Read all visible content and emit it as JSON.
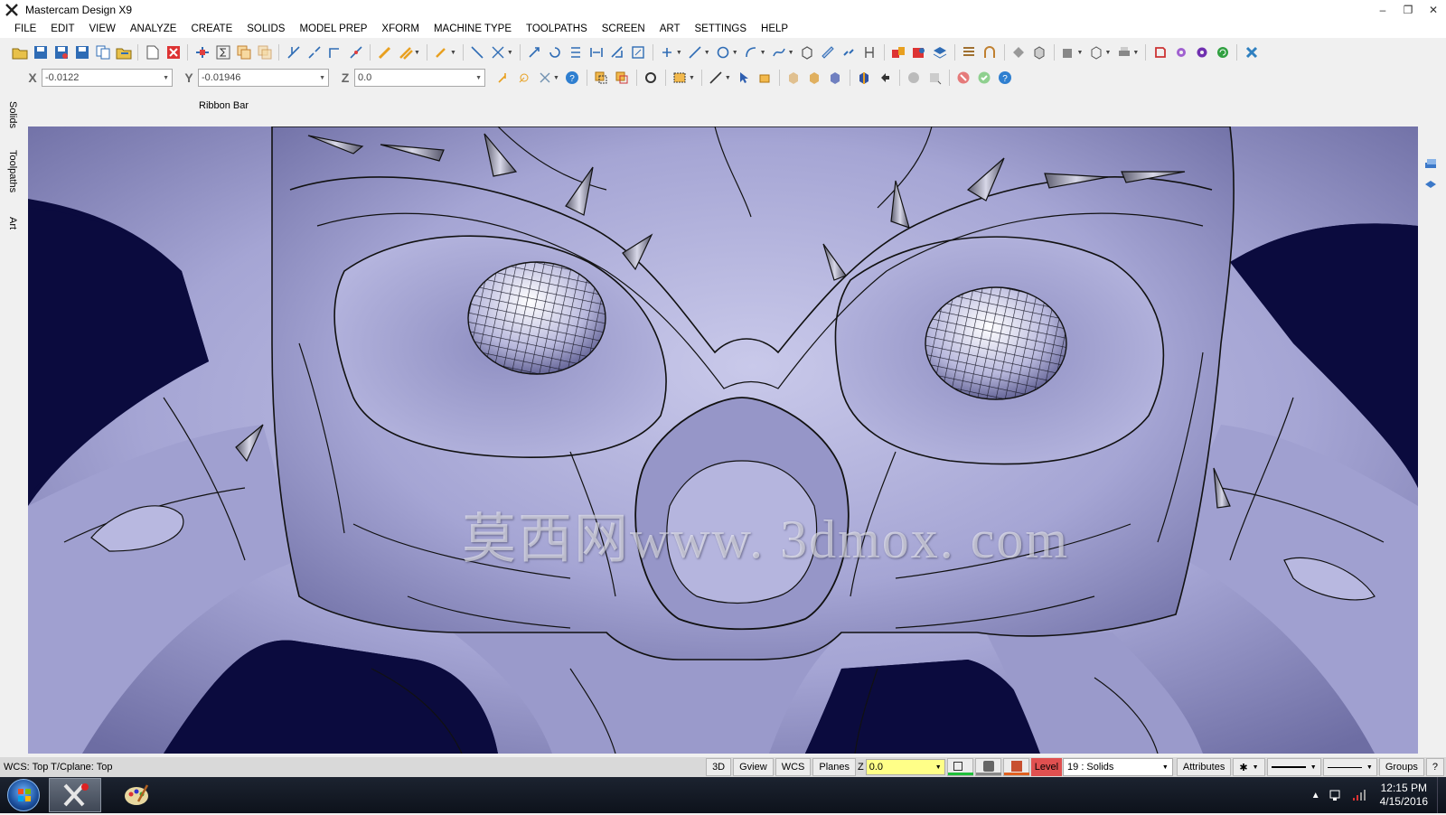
{
  "window": {
    "title": "Mastercam Design X9"
  },
  "menu": [
    "FILE",
    "EDIT",
    "VIEW",
    "ANALYZE",
    "CREATE",
    "SOLIDS",
    "MODEL PREP",
    "XFORM",
    "MACHINE TYPE",
    "TOOLPATHS",
    "SCREEN",
    "ART",
    "SETTINGS",
    "HELP"
  ],
  "coords": {
    "x_label": "X",
    "x_value": "-0.0122",
    "y_label": "Y",
    "y_value": "-0.01946",
    "z_label": "Z",
    "z_value": "0.0"
  },
  "ribbon_label": "Ribbon Bar",
  "side_tabs": [
    "Solids",
    "Toolpaths",
    "Art"
  ],
  "watermark": "莫西网www. 3dmox. com",
  "status": {
    "wcs": "WCS: Top  T/Cplane: Top",
    "btn_3d": "3D",
    "gview": "Gview",
    "wcs_btn": "WCS",
    "planes": "Planes",
    "z_label": "Z",
    "z_value": "0.0",
    "level_label": "Level",
    "level_value": "19 : Solids",
    "attributes": "Attributes",
    "groups": "Groups",
    "help": "?"
  },
  "taskbar": {
    "time": "12:15 PM",
    "date": "4/15/2016"
  },
  "colors": {
    "model": "#a9a9d6",
    "background": "#0b0b3e",
    "level_accent": "#e05050",
    "z_field": "#ffff88"
  }
}
